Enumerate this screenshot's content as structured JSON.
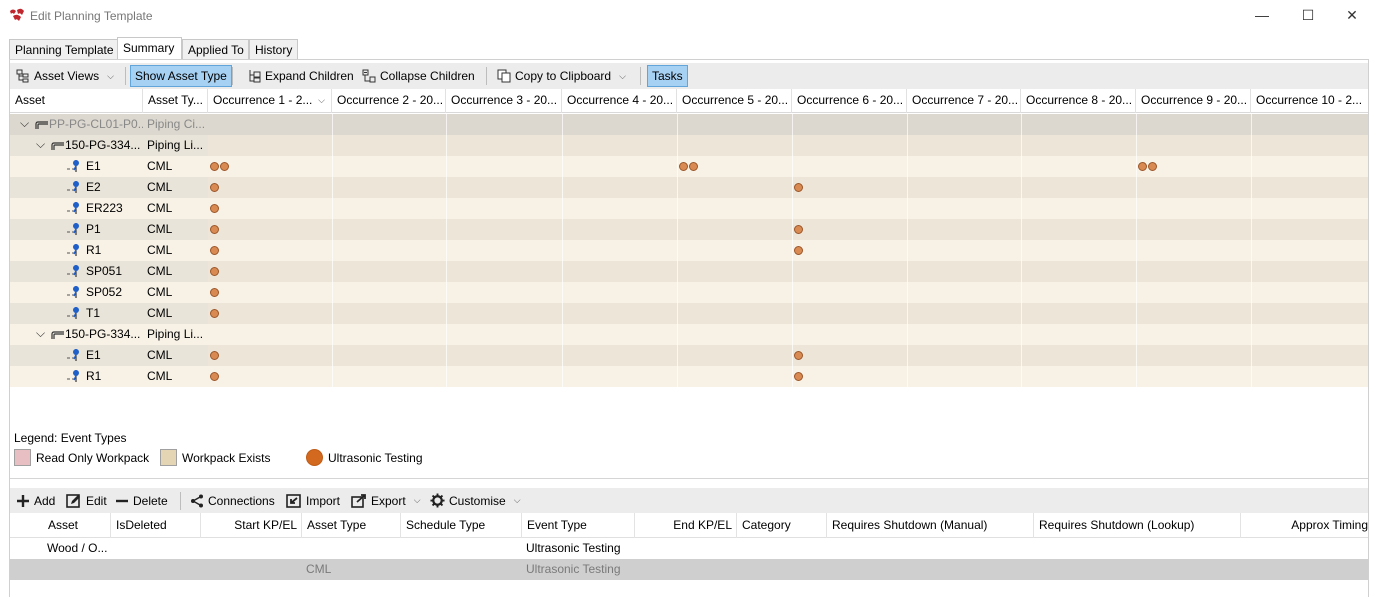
{
  "window": {
    "title": "Edit Planning Template",
    "controls": {
      "minimize": "—",
      "maximize": "☐",
      "close": "✕"
    }
  },
  "tabs": [
    {
      "label": "Planning Template",
      "active": false
    },
    {
      "label": "Summary",
      "active": true
    },
    {
      "label": "Applied To",
      "active": false
    },
    {
      "label": "History",
      "active": false
    }
  ],
  "toolbar": {
    "asset_views": "Asset Views",
    "show_asset_type": "Show Asset Type",
    "expand_children": "Expand Children",
    "collapse_children": "Collapse Children",
    "copy_to_clipboard": "Copy to Clipboard",
    "tasks": "Tasks"
  },
  "grid": {
    "columns": [
      "Asset",
      "Asset Ty...",
      "Occurrence 1 - 2...",
      "Occurrence 2 - 20...",
      "Occurrence 3 - 20...",
      "Occurrence 4 - 20...",
      "Occurrence 5 - 20...",
      "Occurrence 6 - 20...",
      "Occurrence 7 - 20...",
      "Occurrence 8 - 20...",
      "Occurrence 9 - 20...",
      "Occurrence 10 - 2..."
    ],
    "rows": [
      {
        "asset": "PP-PG-CL01-P0...",
        "type": "Piping Ci...",
        "level": 0,
        "kind": "root",
        "events": [
          0,
          0,
          0,
          0,
          0,
          0,
          0,
          0,
          0,
          0
        ]
      },
      {
        "asset": "150-PG-334...",
        "type": "Piping Li...",
        "level": 1,
        "kind": "line",
        "events": [
          0,
          0,
          0,
          0,
          0,
          0,
          0,
          0,
          0,
          0
        ]
      },
      {
        "asset": "E1",
        "type": "CML",
        "level": 2,
        "kind": "cml",
        "events": [
          2,
          0,
          0,
          0,
          2,
          0,
          0,
          0,
          2,
          0
        ]
      },
      {
        "asset": "E2",
        "type": "CML",
        "level": 2,
        "kind": "cml",
        "events": [
          1,
          0,
          0,
          0,
          0,
          1,
          0,
          0,
          0,
          0
        ]
      },
      {
        "asset": "ER223",
        "type": "CML",
        "level": 2,
        "kind": "cml",
        "events": [
          1,
          0,
          0,
          0,
          0,
          0,
          0,
          0,
          0,
          0
        ]
      },
      {
        "asset": "P1",
        "type": "CML",
        "level": 2,
        "kind": "cml",
        "events": [
          1,
          0,
          0,
          0,
          0,
          1,
          0,
          0,
          0,
          0
        ]
      },
      {
        "asset": "R1",
        "type": "CML",
        "level": 2,
        "kind": "cml",
        "events": [
          1,
          0,
          0,
          0,
          0,
          1,
          0,
          0,
          0,
          0
        ]
      },
      {
        "asset": "SP051",
        "type": "CML",
        "level": 2,
        "kind": "cml",
        "events": [
          1,
          0,
          0,
          0,
          0,
          0,
          0,
          0,
          0,
          0
        ]
      },
      {
        "asset": "SP052",
        "type": "CML",
        "level": 2,
        "kind": "cml",
        "events": [
          1,
          0,
          0,
          0,
          0,
          0,
          0,
          0,
          0,
          0
        ]
      },
      {
        "asset": "T1",
        "type": "CML",
        "level": 2,
        "kind": "cml",
        "events": [
          1,
          0,
          0,
          0,
          0,
          0,
          0,
          0,
          0,
          0
        ]
      },
      {
        "asset": "150-PG-334...",
        "type": "Piping Li...",
        "level": 1,
        "kind": "line",
        "events": [
          0,
          0,
          0,
          0,
          0,
          0,
          0,
          0,
          0,
          0
        ]
      },
      {
        "asset": "E1",
        "type": "CML",
        "level": 2,
        "kind": "cml",
        "events": [
          1,
          0,
          0,
          0,
          0,
          1,
          0,
          0,
          0,
          0
        ]
      },
      {
        "asset": "R1",
        "type": "CML",
        "level": 2,
        "kind": "cml",
        "events": [
          1,
          0,
          0,
          0,
          0,
          1,
          0,
          0,
          0,
          0
        ]
      }
    ]
  },
  "legend": {
    "title": "Legend: Event Types",
    "items": [
      {
        "label": "Read Only Workpack",
        "color": "#e8bfc3"
      },
      {
        "label": "Workpack Exists",
        "color": "#e4d6b5"
      },
      {
        "label": "Ultrasonic Testing",
        "color": "#d2691e"
      }
    ]
  },
  "tasks_toolbar": {
    "add": "Add",
    "edit": "Edit",
    "delete": "Delete",
    "connections": "Connections",
    "import": "Import",
    "export": "Export",
    "customise": "Customise"
  },
  "tasks_table": {
    "columns": [
      "Asset",
      "IsDeleted",
      "Start KP/EL",
      "Asset Type",
      "Schedule Type",
      "Event Type",
      "End KP/EL",
      "Category",
      "Requires Shutdown (Manual)",
      "Requires Shutdown (Lookup)",
      "Approx Timing"
    ],
    "rows": [
      {
        "asset": "Wood / O...",
        "is_deleted": "",
        "start_kp": "",
        "asset_type": "",
        "schedule_type": "",
        "event_type": "Ultrasonic Testing",
        "end_kp": "",
        "category": "",
        "selected": false
      },
      {
        "asset": "",
        "is_deleted": "",
        "start_kp": "",
        "asset_type": "CML",
        "schedule_type": "",
        "event_type": "Ultrasonic Testing",
        "end_kp": "",
        "category": "",
        "selected": true
      }
    ]
  },
  "colors": {
    "accent": "#a7d1f3",
    "root_row": "#dcd8cf",
    "row_light": "#f7f1e6",
    "row_dark": "#ede6d8",
    "selected_row": "#cfcfcf",
    "dot": "#d98a53"
  }
}
